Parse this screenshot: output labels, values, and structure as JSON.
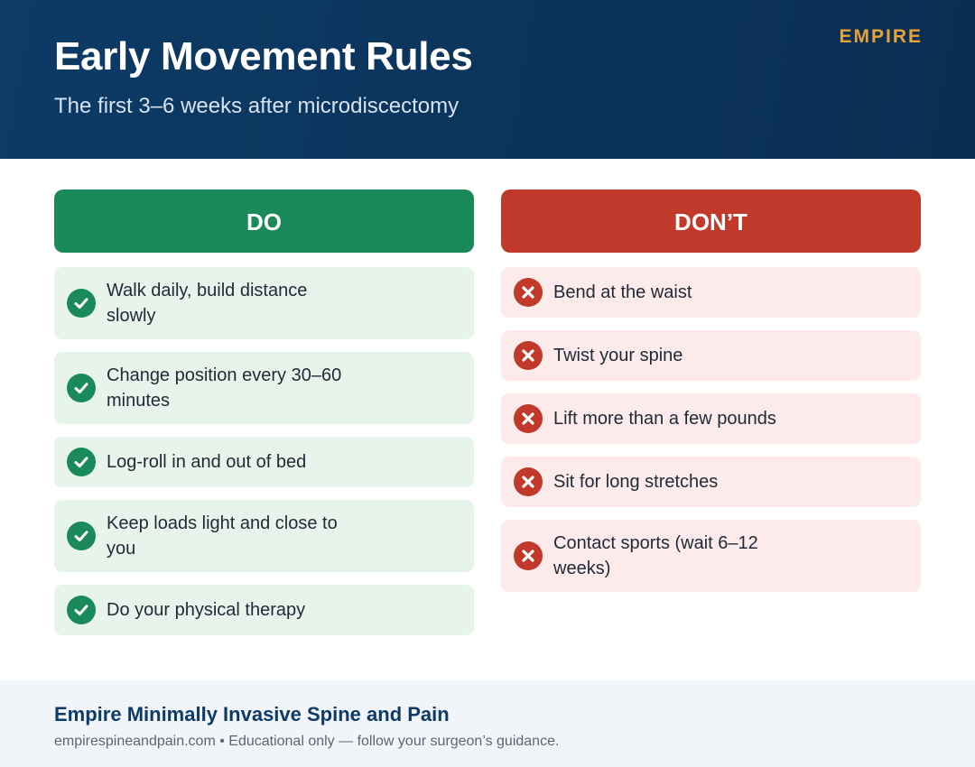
{
  "header": {
    "title": "Early Movement Rules",
    "subtitle": "The first 3–6 weeks after microdiscectomy",
    "brand": "EMPIRE"
  },
  "do_column": {
    "heading": "DO",
    "icon": "check-circle-icon",
    "items": [
      {
        "text": "Walk daily, build distance slowly"
      },
      {
        "text": "Change position every 30–60 minutes"
      },
      {
        "text": "Log-roll in and out of bed"
      },
      {
        "text": "Keep loads light and close to you"
      },
      {
        "text": "Do your physical therapy"
      }
    ]
  },
  "dont_column": {
    "heading": "DON’T",
    "icon": "x-circle-icon",
    "items": [
      {
        "text": "Bend at the waist"
      },
      {
        "text": "Twist your spine"
      },
      {
        "text": "Lift more than a few pounds"
      },
      {
        "text": "Sit for long stretches"
      },
      {
        "text": "Contact sports (wait 6–12 weeks)"
      }
    ]
  },
  "footer": {
    "organization": "Empire Minimally Invasive Spine and Pain",
    "note": "empirespineandpain.com • Educational only — follow your surgeon’s guidance."
  },
  "colors": {
    "header_bg": "#0d3b66",
    "brand_accent": "#e9a23b",
    "do_green": "#1a8a5b",
    "do_item_bg": "#e6f4ec",
    "dont_red": "#c0392b",
    "dont_item_bg": "#fdeaea",
    "footer_bg": "#f1f5f9"
  }
}
